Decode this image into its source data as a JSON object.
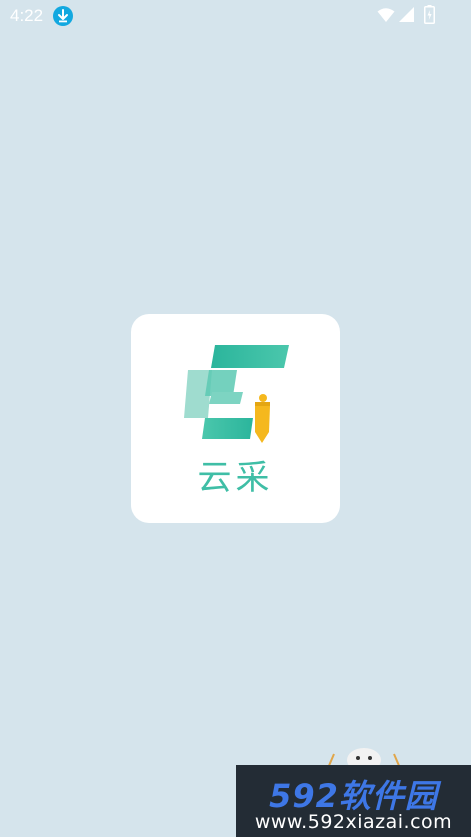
{
  "status_bar": {
    "time": "4:22",
    "icons": [
      "download-icon",
      "wifi-icon",
      "signal-icon",
      "battery-icon"
    ]
  },
  "splash": {
    "app_name": "云采",
    "logo": "yuncai-logo-icon",
    "colors": {
      "background": "#d5e4ec",
      "card": "#ffffff",
      "teal": "#3fbea6",
      "teal_light": "#9fdccf",
      "yellow": "#f5b81e"
    }
  },
  "watermark": {
    "brand": "592软件园",
    "url": "www.592xiazai.com",
    "colors": {
      "background": "#232c35",
      "brand": "#3e77e6",
      "url": "#ffffff"
    }
  }
}
